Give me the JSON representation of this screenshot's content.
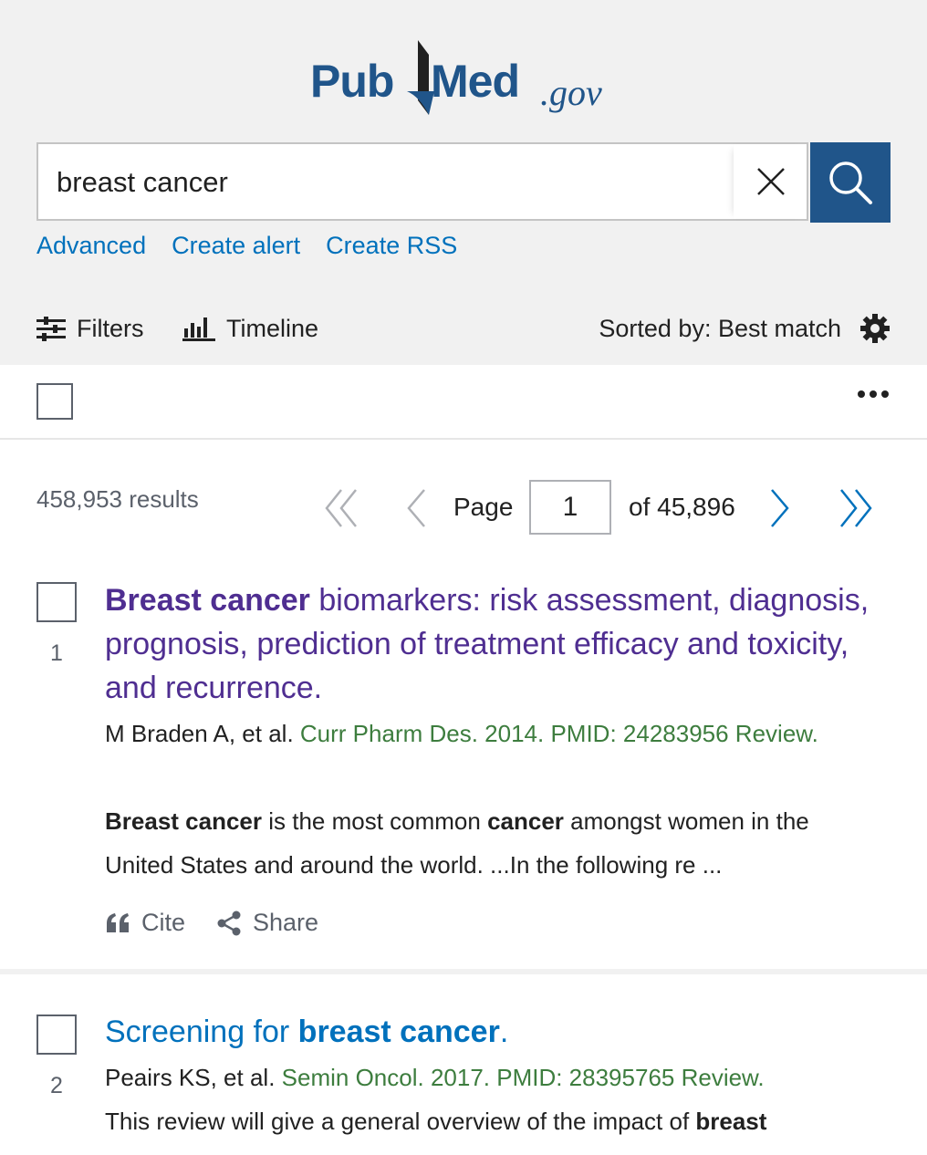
{
  "logo": {
    "pub": "Pub",
    "med": "Med",
    "gov": ".gov"
  },
  "search": {
    "query": "breast cancer"
  },
  "links": [
    "Advanced",
    "Create alert",
    "Create RSS"
  ],
  "toolbar": {
    "filters": "Filters",
    "timeline": "Timeline",
    "sort": "Sorted by: Best match"
  },
  "results": {
    "count": "458,953 results",
    "page_label": "Page",
    "page_value": "1",
    "page_of": "of 45,896"
  },
  "items": [
    {
      "number": "1",
      "title_hl": "Breast cancer",
      "title_rest": " biomarkers: risk assessment, diagnosis, prognosis, prediction of treatment efficacy and toxicity, and recurrence.",
      "authors": "M Braden A, et al.",
      "journal": "Curr Pharm Des. 2014. PMID: 24283956 Review.",
      "snippet": [
        {
          "b": true,
          "t": "Breast cancer"
        },
        {
          "b": false,
          "t": " is the most common "
        },
        {
          "b": true,
          "t": "cancer"
        },
        {
          "b": false,
          "t": " amongst women in the United States and around the world. ...In the following re ..."
        }
      ],
      "cite": "Cite",
      "share": "Share"
    },
    {
      "number": "2",
      "title_pre": "Screening for ",
      "title_hl": "breast cancer",
      "title_post": ".",
      "authors": "Peairs KS, et al.",
      "journal": "Semin Oncol. 2017. PMID: 28395765 Review.",
      "snippet": [
        {
          "b": false,
          "t": "This review will give a general overview of the impact of "
        },
        {
          "b": true,
          "t": "breast"
        }
      ]
    }
  ],
  "colors": {
    "brand": "#20558a",
    "link": "#0071bc",
    "visited": "#4f2e91",
    "journal": "#3d7d3e"
  }
}
